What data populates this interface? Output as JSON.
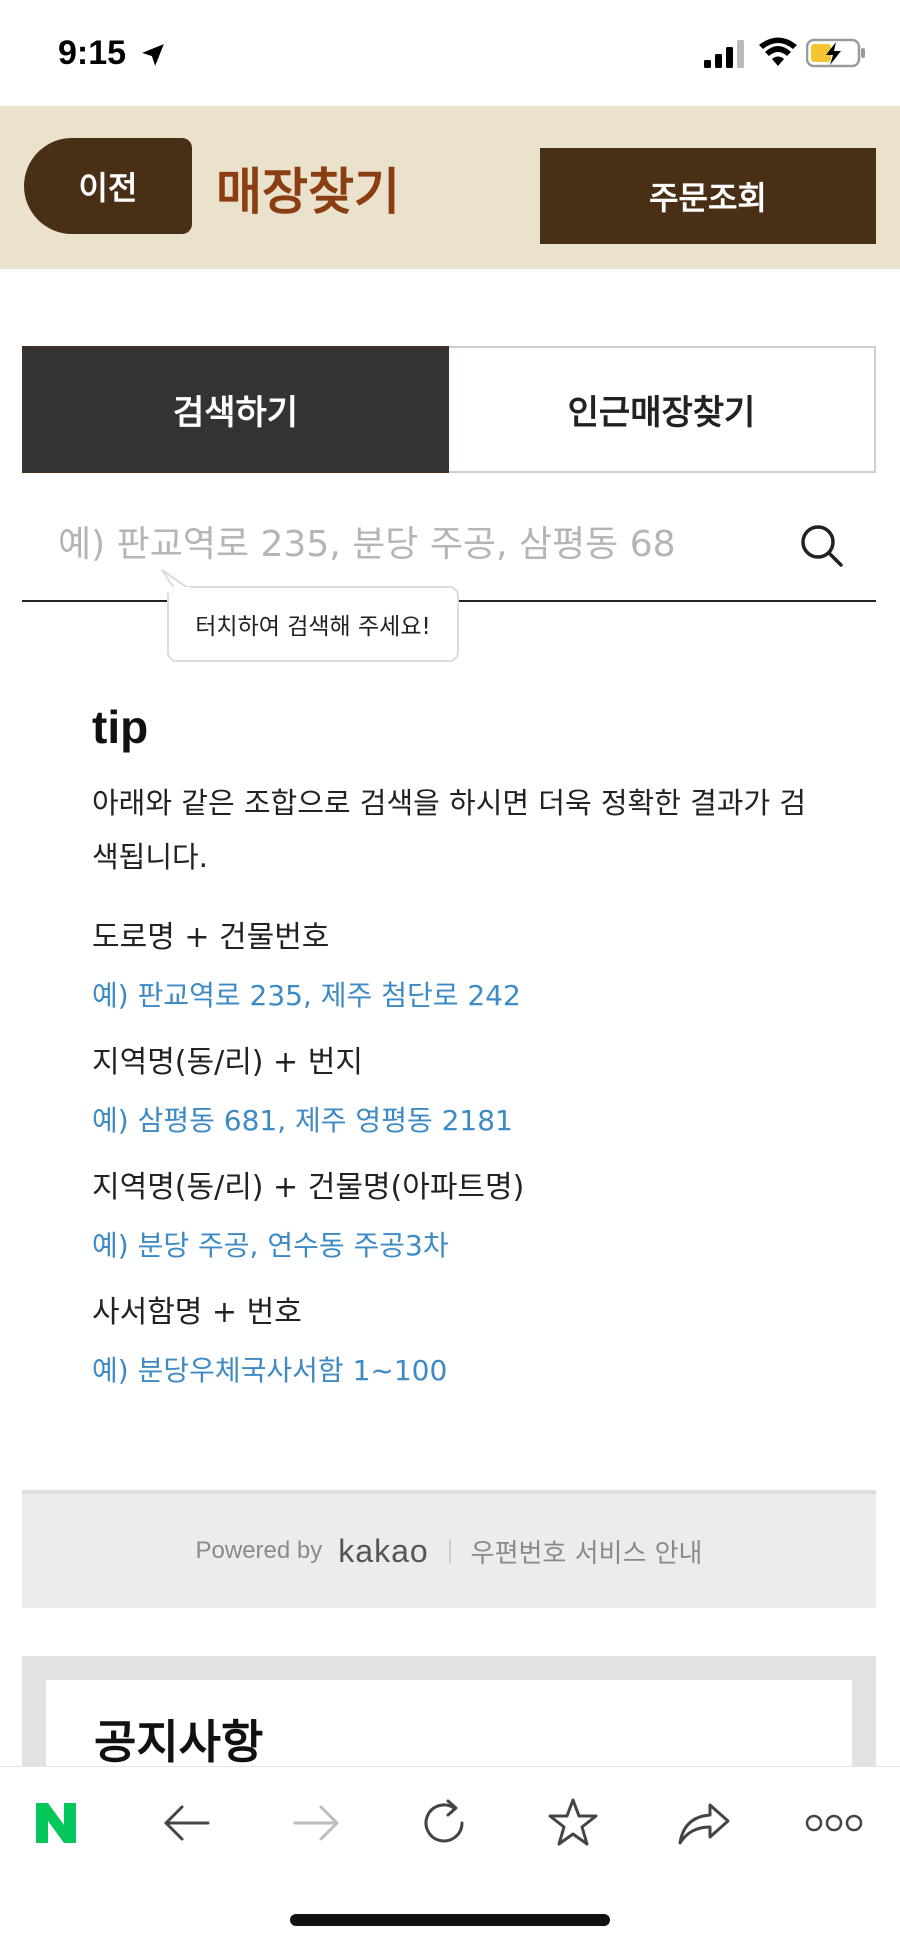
{
  "status_bar": {
    "time": "9:15"
  },
  "header": {
    "back_label": "이전",
    "title": "매장찾기",
    "order_label": "주문조회"
  },
  "tabs": [
    {
      "label": "검색하기",
      "active": true
    },
    {
      "label": "인근매장찾기",
      "active": false
    }
  ],
  "search": {
    "placeholder": "예) 판교역로 235, 분당 주공, 삼평동 68",
    "value": "",
    "tooltip": "터치하여 검색해 주세요!"
  },
  "tip": {
    "title": "tip",
    "description": "아래와 같은 조합으로 검색을 하시면 더욱 정확한 결과가 검색됩니다.",
    "items": [
      {
        "label": "도로명 + 건물번호",
        "example": "예) 판교역로 235,  제주 첨단로 242"
      },
      {
        "label": "지역명(동/리) + 번지",
        "example": "예) 삼평동 681,  제주 영평동 2181"
      },
      {
        "label": "지역명(동/리) + 건물명(아파트명)",
        "example": "예) 분당 주공,  연수동 주공3차"
      },
      {
        "label": "사서함명 + 번호",
        "example": "예) 분당우체국사서함 1~100"
      }
    ]
  },
  "powered": {
    "powered_by": "Powered by",
    "brand": "kakao",
    "postcode_link": "우편번호 서비스 안내"
  },
  "notice": {
    "title": "공지사항"
  },
  "toolbar": {
    "icons": [
      "naver-logo-icon",
      "back-arrow-icon",
      "forward-arrow-icon",
      "reload-icon",
      "star-icon",
      "share-icon",
      "more-icon"
    ],
    "logo_letter": "N"
  },
  "colors": {
    "header_bg": "#ebe2cd",
    "brand_brown": "#4a2f17",
    "title_brown": "#8b3e12",
    "example_blue": "#3d8ac4",
    "naver_green": "#03c75a"
  }
}
